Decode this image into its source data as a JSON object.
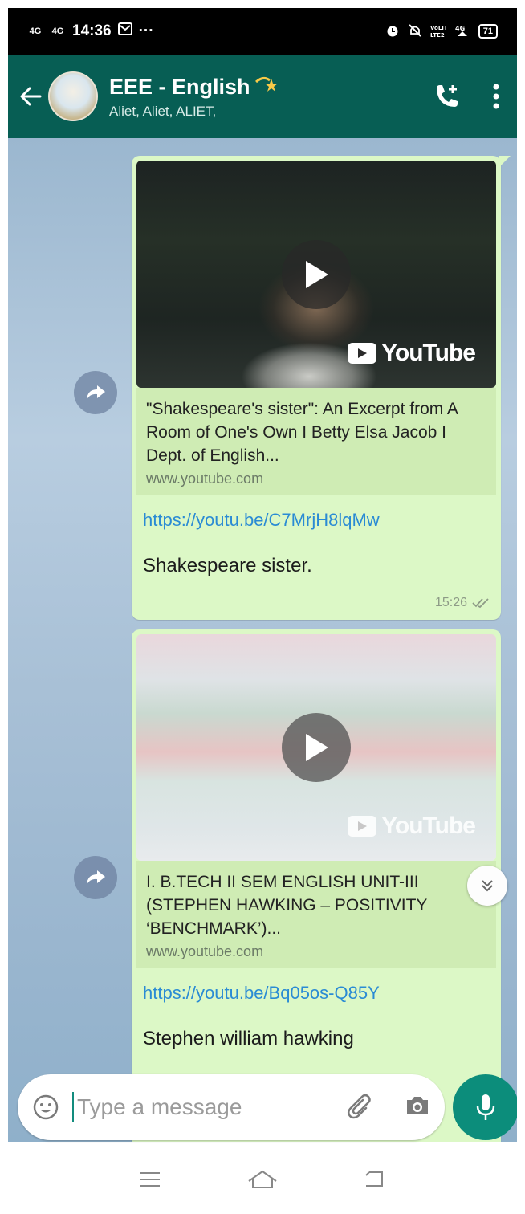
{
  "status_bar": {
    "signal1": "4G",
    "signal2": "4G",
    "time": "14:36",
    "dots": "···",
    "battery": "71"
  },
  "header": {
    "title": "EEE - English",
    "subtitle": "Aliet, Aliet, ALIET,"
  },
  "messages": [
    {
      "preview_title": "\"Shakespeare's sister\": An Excerpt from A Room of One's Own I Betty Elsa Jacob I Dept. of English...",
      "preview_domain": "www.youtube.com",
      "link": "https://youtu.be/C7MrjH8lqMw",
      "text": "Shakespeare sister.",
      "time": "15:26",
      "badge": "YouTube"
    },
    {
      "preview_title": "I. B.TECH II SEM ENGLISH UNIT-III (STEPHEN HAWKING – POSITIVITY ‘BENCHMARK’)...",
      "preview_domain": "www.youtube.com",
      "link": "https://youtu.be/Bq05os-Q85Y",
      "text": "Stephen william hawking",
      "badge": "YouTube"
    }
  ],
  "composer": {
    "placeholder": "Type a message"
  },
  "colors": {
    "header": "#075e54",
    "bubble": "#dcf8c6",
    "link": "#2a8bd4",
    "mic": "#0c8d7b"
  }
}
